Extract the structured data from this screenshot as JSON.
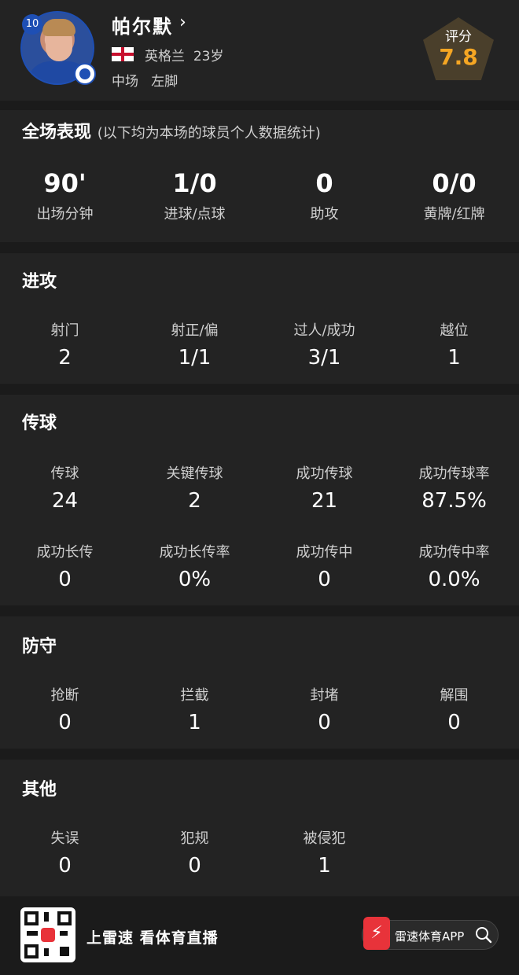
{
  "player": {
    "number": "10",
    "name": "帕尔默",
    "nationality": "英格兰",
    "age": "23岁",
    "position": "中场",
    "foot": "左脚",
    "rating_label": "评分",
    "rating": "7.8"
  },
  "overview": {
    "title": "全场表现",
    "note": "(以下均为本场的球员个人数据统计)",
    "stats": [
      {
        "label": "出场分钟",
        "value": "90'"
      },
      {
        "label": "进球/点球",
        "value": "1/0"
      },
      {
        "label": "助攻",
        "value": "0"
      },
      {
        "label": "黄牌/红牌",
        "value": "0/0"
      }
    ]
  },
  "attack": {
    "title": "进攻",
    "stats": [
      {
        "label": "射门",
        "value": "2"
      },
      {
        "label": "射正/偏",
        "value": "1/1"
      },
      {
        "label": "过人/成功",
        "value": "3/1"
      },
      {
        "label": "越位",
        "value": "1"
      }
    ]
  },
  "passing": {
    "title": "传球",
    "stats": [
      {
        "label": "传球",
        "value": "24"
      },
      {
        "label": "关键传球",
        "value": "2"
      },
      {
        "label": "成功传球",
        "value": "21"
      },
      {
        "label": "成功传球率",
        "value": "87.5%"
      },
      {
        "label": "成功长传",
        "value": "0"
      },
      {
        "label": "成功长传率",
        "value": "0%"
      },
      {
        "label": "成功传中",
        "value": "0"
      },
      {
        "label": "成功传中率",
        "value": "0.0%"
      }
    ]
  },
  "defense": {
    "title": "防守",
    "stats": [
      {
        "label": "抢断",
        "value": "0"
      },
      {
        "label": "拦截",
        "value": "1"
      },
      {
        "label": "封堵",
        "value": "0"
      },
      {
        "label": "解围",
        "value": "0"
      }
    ]
  },
  "other": {
    "title": "其他",
    "stats": [
      {
        "label": "失误",
        "value": "0"
      },
      {
        "label": "犯规",
        "value": "0"
      },
      {
        "label": "被侵犯",
        "value": "1"
      }
    ]
  },
  "footer": {
    "slogan": "上雷速 看体育直播",
    "app_name": "雷速体育APP"
  },
  "colors": {
    "background": "#1b1b1b",
    "panel": "#232323",
    "rating_accent": "#f5a623",
    "club_blue": "#1e4fb4",
    "brand_red": "#e8333a"
  }
}
